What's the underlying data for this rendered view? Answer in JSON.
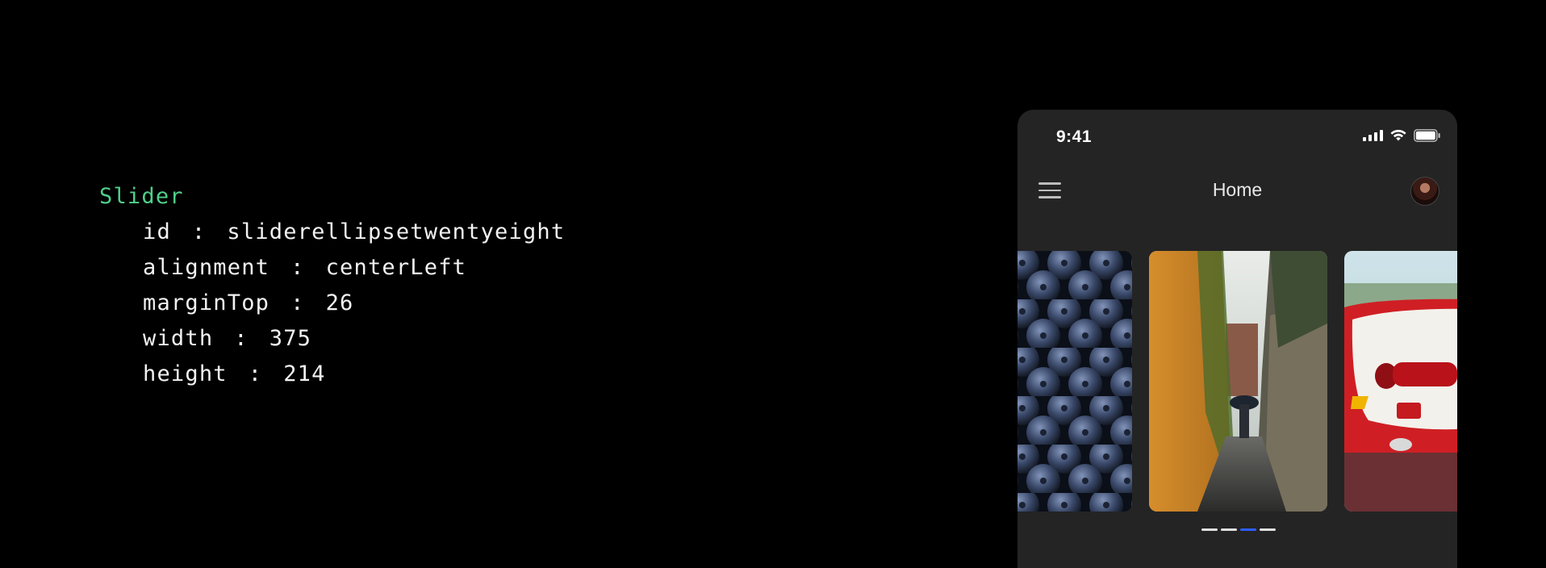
{
  "code": {
    "widget": "Slider",
    "properties": [
      {
        "key": "id",
        "value": "sliderellipsetwentyeight"
      },
      {
        "key": "alignment",
        "value": "centerLeft"
      },
      {
        "key": "marginTop",
        "value": "26"
      },
      {
        "key": "width",
        "value": "375"
      },
      {
        "key": "height",
        "value": "214"
      }
    ]
  },
  "phone": {
    "status_time": "9:41",
    "title": "Home",
    "icons": [
      "menu-icon",
      "avatar",
      "cellular-signal-icon",
      "wifi-icon",
      "battery-icon"
    ],
    "slides": [
      "blueberries",
      "alley-umbrella",
      "red-car"
    ],
    "indicator_count": 4,
    "active_indicator": 2,
    "accent_color": "#2f5dff"
  }
}
